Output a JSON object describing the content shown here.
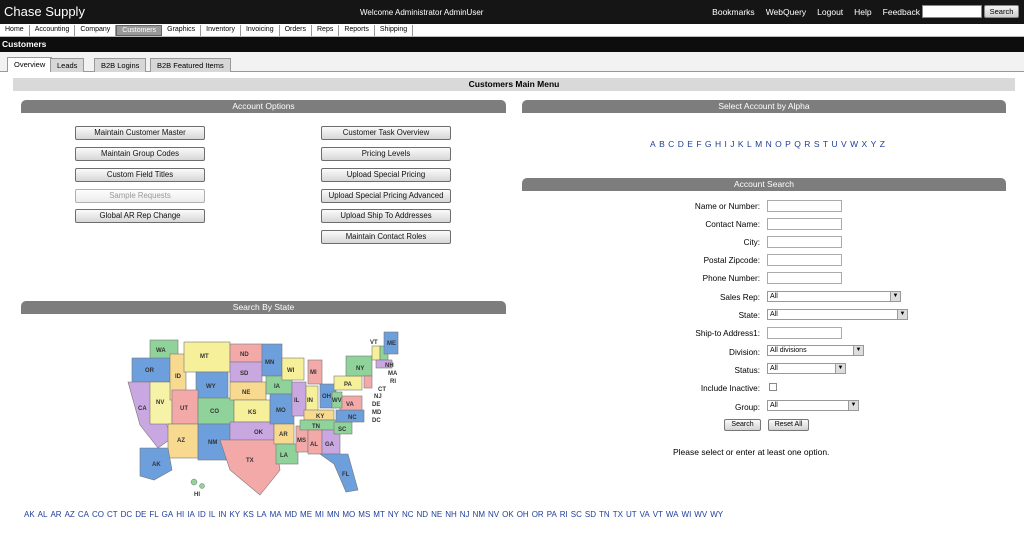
{
  "header": {
    "brand": "Chase Supply",
    "welcome": "Welcome  Administrator AdminUser",
    "links": [
      "Bookmarks",
      "WebQuery",
      "Logout",
      "Help",
      "Feedback"
    ],
    "search_label": "Search"
  },
  "nav": [
    "Home",
    "Accounting",
    "Company",
    "Customers",
    "Graphics",
    "Inventory",
    "Invoicing",
    "Orders",
    "Reps",
    "Reports",
    "Shipping"
  ],
  "section_title": "Customers",
  "subtabs": [
    "Overview",
    "Leads",
    "B2B Logins",
    "B2B Featured Items"
  ],
  "main_menu_title": "Customers Main Menu",
  "account_options": {
    "title": "Account Options",
    "left_buttons": [
      "Maintain Customer Master",
      "Maintain Group Codes",
      "Custom Field Titles",
      "Sample Requests",
      "Global AR Rep Change"
    ],
    "right_buttons": [
      "Customer Task Overview",
      "Pricing Levels",
      "Upload Special Pricing",
      "Upload Special Pricing Advanced",
      "Upload Ship To Addresses",
      "Maintain Contact Roles"
    ]
  },
  "select_by_alpha": {
    "title": "Select Account by Alpha",
    "letters": [
      "A",
      "B",
      "C",
      "D",
      "E",
      "F",
      "G",
      "H",
      "I",
      "J",
      "K",
      "L",
      "M",
      "N",
      "O",
      "P",
      "Q",
      "R",
      "S",
      "T",
      "U",
      "V",
      "W",
      "X",
      "Y",
      "Z"
    ]
  },
  "account_search": {
    "title": "Account Search",
    "labels": {
      "name": "Name or Number:",
      "contact": "Contact Name:",
      "city": "City:",
      "zip": "Postal Zipcode:",
      "phone": "Phone Number:",
      "rep": "Sales Rep:",
      "state": "State:",
      "shipto": "Ship-to Address1:",
      "division": "Division:",
      "status": "Status:",
      "inactive": "Include Inactive:",
      "group": "Group:"
    },
    "values": {
      "rep": "All",
      "state": "All",
      "division": "All divisions",
      "status": "All",
      "group": "All"
    },
    "search_button": "Search",
    "reset_button": "Reset All",
    "hint": "Please select or enter at least one option."
  },
  "search_by_state": {
    "title": "Search By State",
    "map_labels": [
      "WA",
      "OR",
      "CA",
      "NV",
      "ID",
      "MT",
      "WY",
      "UT",
      "AZ",
      "CO",
      "NM",
      "ND",
      "SD",
      "NE",
      "KS",
      "OK",
      "TX",
      "MN",
      "IA",
      "MO",
      "AR",
      "LA",
      "WI",
      "IL",
      "MS",
      "MI",
      "IN",
      "KY",
      "TN",
      "AL",
      "OH",
      "GA",
      "FL",
      "SC",
      "NC",
      "VA",
      "WV",
      "PA",
      "NY",
      "VT",
      "NH",
      "ME",
      "MA",
      "RI",
      "CT",
      "NJ",
      "DE",
      "MD",
      "DC",
      "AK",
      "HI"
    ],
    "state_links": [
      "AK",
      "AL",
      "AR",
      "AZ",
      "CA",
      "CO",
      "CT",
      "DC",
      "DE",
      "FL",
      "GA",
      "HI",
      "IA",
      "ID",
      "IL",
      "IN",
      "KY",
      "KS",
      "LA",
      "MA",
      "MD",
      "ME",
      "MI",
      "MN",
      "MO",
      "MS",
      "MT",
      "NY",
      "NC",
      "ND",
      "NE",
      "NH",
      "NJ",
      "NM",
      "NV",
      "OK",
      "OH",
      "OR",
      "PA",
      "RI",
      "SC",
      "SD",
      "TN",
      "TX",
      "UT",
      "VA",
      "VT",
      "WA",
      "WI",
      "WV",
      "WY"
    ]
  },
  "colors": {
    "header_bg": "#151515",
    "panel_header": "#7d7d7d",
    "link": "#1f3f9a"
  }
}
